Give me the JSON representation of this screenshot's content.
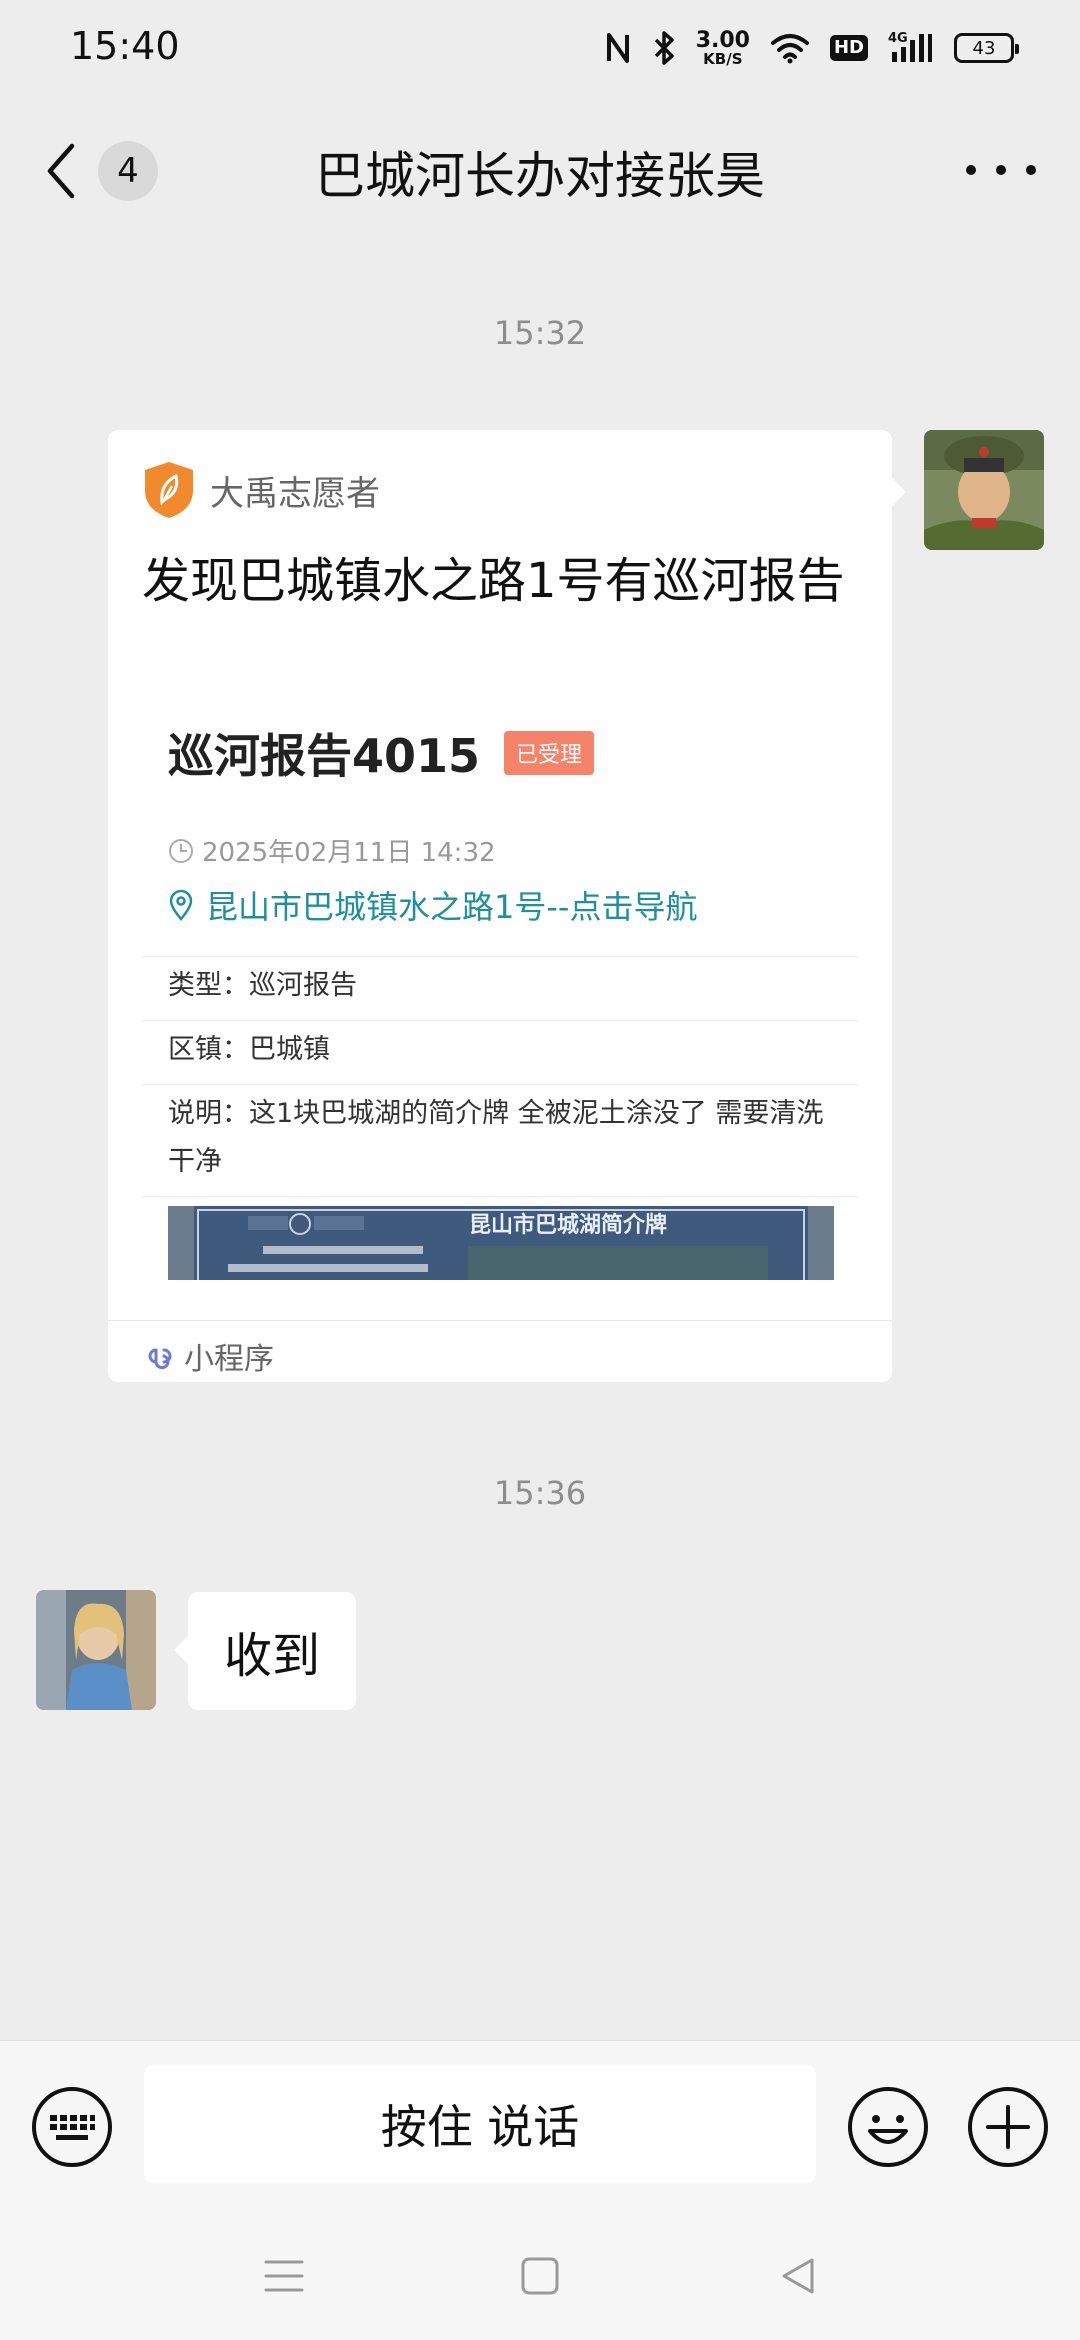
{
  "status_bar": {
    "time": "15:40",
    "net_speed_value": "3.00",
    "net_speed_unit": "KB/S",
    "hd": "HD",
    "cell": "4G",
    "battery": "43",
    "icons": [
      "nfc-icon",
      "bluetooth-icon",
      "wifi-icon",
      "hd-voice-icon",
      "signal-icon",
      "battery-icon"
    ]
  },
  "header": {
    "back_icon": "chevron-left-icon",
    "unread_count": "4",
    "title": "巴城河长办对接张昊",
    "more_icon": "more-dots-icon"
  },
  "messages": [
    {
      "type": "timestamp",
      "text": "15:32"
    },
    {
      "type": "mini_program",
      "sender": "self",
      "source_name": "大禹志愿者",
      "title": "发现巴城镇水之路1号有巡河报告",
      "preview": {
        "report_title": "巡河报告4015",
        "status": "已受理",
        "time": "2025年02月11日 14:32",
        "location": "昆山市巴城镇水之路1号--点击导航",
        "fields": [
          {
            "label": "类型：",
            "value": "巡河报告"
          },
          {
            "label": "区镇：",
            "value": "巴城镇"
          },
          {
            "label": "说明：",
            "value": "这1块巴城湖的简介牌 全被泥土涂没了 需要清洗干净"
          }
        ],
        "photo_sign_title": "昆山市巴城湖简介牌"
      },
      "footer_label": "小程序"
    },
    {
      "type": "timestamp",
      "text": "15:36"
    },
    {
      "type": "text",
      "sender": "other",
      "text": "收到"
    }
  ],
  "input_bar": {
    "keyboard_icon": "keyboard-icon",
    "talk_label": "按住 说话",
    "emoji_icon": "emoji-icon",
    "plus_icon": "plus-icon"
  },
  "nav_bar": {
    "icons": [
      "menu-icon",
      "home-icon",
      "back-icon"
    ]
  },
  "colors": {
    "background": "#ededed",
    "link": "#1e8fa0",
    "status_badge": "#f4836a",
    "source_shield": "#f08a2c"
  }
}
